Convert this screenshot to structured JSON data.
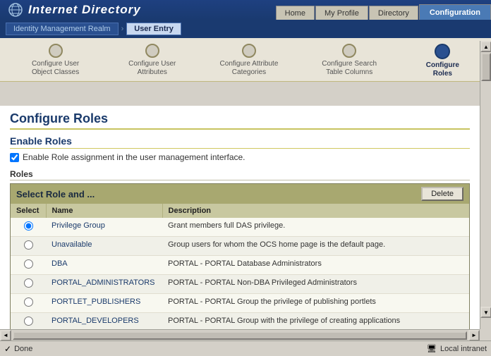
{
  "app": {
    "title": "Internet Directory"
  },
  "nav": {
    "tabs": [
      {
        "label": "Home",
        "active": false
      },
      {
        "label": "My Profile",
        "active": false
      },
      {
        "label": "Directory",
        "active": false
      },
      {
        "label": "Configuration",
        "active": true
      }
    ]
  },
  "breadcrumb": {
    "items": [
      {
        "label": "Identity Management Realm",
        "active": false
      },
      {
        "label": "User Entry",
        "active": true
      }
    ]
  },
  "wizard": {
    "steps": [
      {
        "label": "Configure User\nObject Classes",
        "active": false
      },
      {
        "label": "Configure User\nAttributes",
        "active": false
      },
      {
        "label": "Configure Attribute\nCategories",
        "active": false
      },
      {
        "label": "Configure Search\nTable Columns",
        "active": false
      },
      {
        "label": "Configure\nRoles",
        "active": true
      }
    ]
  },
  "page": {
    "heading": "Configure Roles",
    "section1": {
      "heading": "Enable Roles",
      "checkbox_label": "Enable Role assignment in the user management interface.",
      "checkbox_checked": true
    },
    "roles_section": {
      "label": "Roles",
      "table": {
        "header_title": "Select Role and ...",
        "delete_button": "Delete",
        "columns": [
          {
            "label": "Select"
          },
          {
            "label": "Name"
          },
          {
            "label": "Description"
          }
        ],
        "rows": [
          {
            "selected": true,
            "name": "Privilege Group",
            "description": "Grant members full DAS privilege."
          },
          {
            "selected": false,
            "name": "Unavailable",
            "description": "Group users for whom the OCS home page is the default page."
          },
          {
            "selected": false,
            "name": "DBA",
            "description": "PORTAL - PORTAL Database Administrators"
          },
          {
            "selected": false,
            "name": "PORTAL_ADMINISTRATORS",
            "description": "PORTAL - PORTAL Non-DBA Privileged Administrators"
          },
          {
            "selected": false,
            "name": "PORTLET_PUBLISHERS",
            "description": "PORTAL - PORTAL Group the privilege of publishing portlets"
          },
          {
            "selected": false,
            "name": "PORTAL_DEVELOPERS",
            "description": "PORTAL - PORTAL Group with the privilege of creating applications"
          }
        ]
      }
    }
  },
  "status": {
    "left": "Done",
    "right": "Local intranet"
  }
}
